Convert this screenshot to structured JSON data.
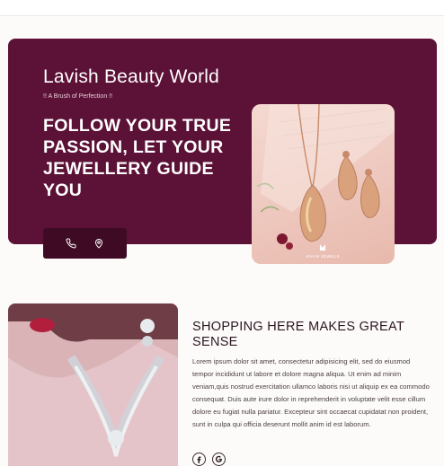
{
  "hero": {
    "brand": "Lavish Beauty World",
    "tagline": "!! A Brush of Perfection !!",
    "headline": "Follow your true passion, let your jewellery guide you",
    "image_caption": "KHAN JEWELS",
    "contact_icons": [
      "phone-icon",
      "location-pin-icon"
    ]
  },
  "section": {
    "title": "Shopping here makes great sense",
    "body": "Lorem ipsum dolor sit amet, consectetur adipisicing elit, sed do eiusmod tempor incididunt ut labore et dolore magna aliqua. Ut enim ad minim veniam,quis nostrud exercitation ullamco laboris nisi ut aliquip ex ea commodo consequat. Duis aute irure dolor in reprehenderit in voluptate velit esse cillum dolore eu fugiat nulla pariatur. Excepteur sint occaecat cupidatat non proident, sunt in culpa qui officia deserunt mollit anim id est laborum.",
    "socials": [
      "facebook-icon",
      "google-icon"
    ]
  },
  "colors": {
    "hero_bg": "#5c1136",
    "contact_bar_bg": "#3f0a24",
    "page_bg": "#fdfbfa"
  }
}
